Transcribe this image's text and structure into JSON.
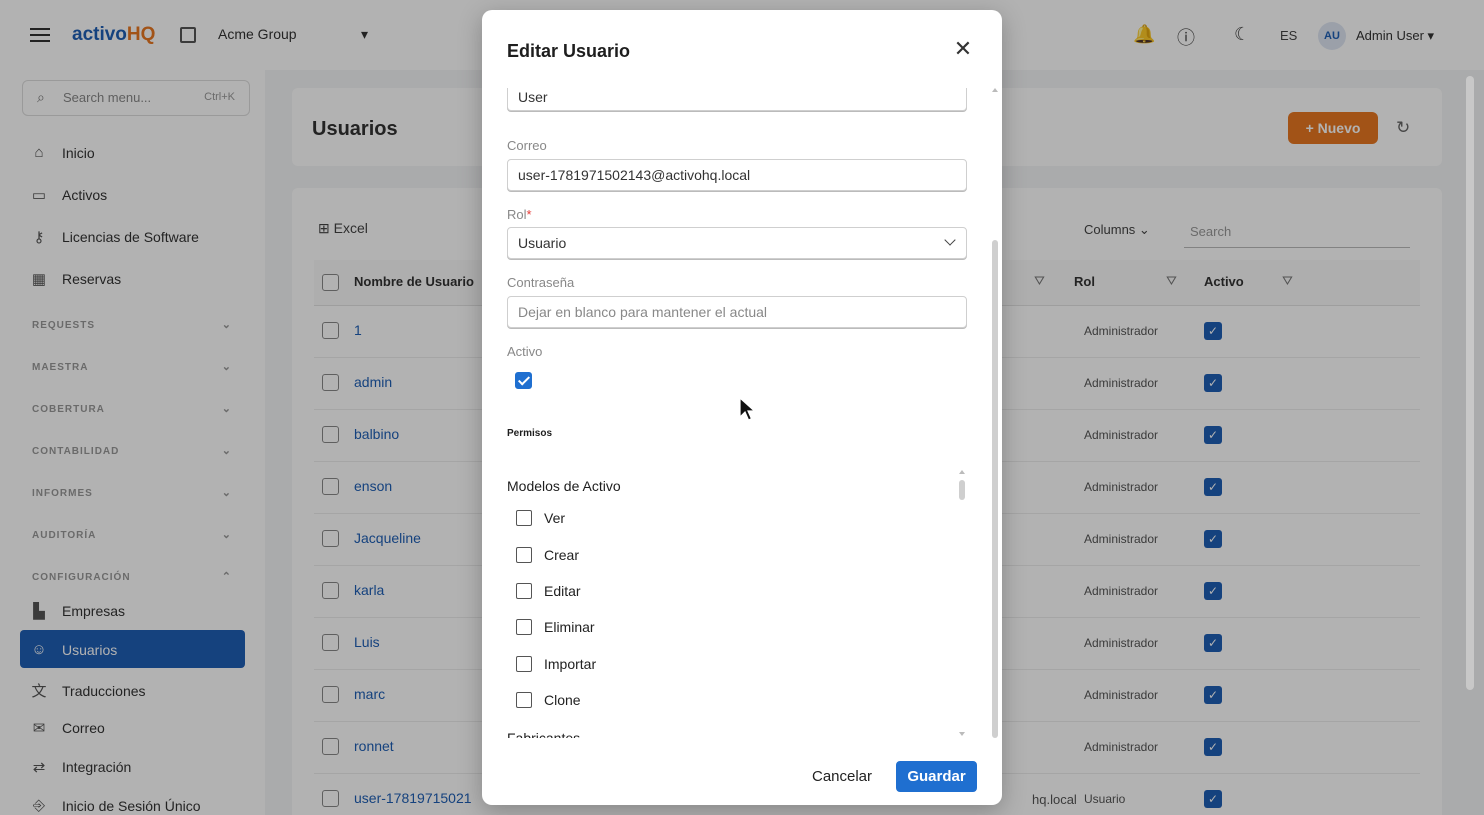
{
  "app": {
    "logo_main": "activo",
    "logo_accent": "HQ",
    "company": "Acme Group",
    "language": "ES",
    "avatar_initials": "AU",
    "user_name": "Admin User"
  },
  "sidebar": {
    "search_placeholder": "Search menu...",
    "search_shortcut": "Ctrl+K",
    "items_top": [
      "Inicio",
      "Activos",
      "Licencias de Software",
      "Reservas"
    ],
    "sections": [
      "REQUESTS",
      "MAESTRA",
      "COBERTURA",
      "CONTABILIDAD",
      "INFORMES",
      "AUDITORÍA",
      "CONFIGURACIÓN"
    ],
    "items_config": [
      "Empresas",
      "Usuarios",
      "Traducciones",
      "Correo",
      "Integración",
      "Inicio de Sesión Único"
    ]
  },
  "page": {
    "title": "Usuarios",
    "new_button": "+ Nuevo"
  },
  "table": {
    "excel_label": "Excel",
    "columns_label": "Columns",
    "search_placeholder": "Search",
    "headers": [
      "Nombre de Usuario",
      "Rol",
      "Activo"
    ],
    "rows": [
      {
        "username": "1",
        "role": "Administrador"
      },
      {
        "username": "admin",
        "role": "Administrador"
      },
      {
        "username": "balbino",
        "role": "Administrador"
      },
      {
        "username": "enson",
        "role": "Administrador"
      },
      {
        "username": "Jacqueline",
        "role": "Administrador"
      },
      {
        "username": "karla",
        "role": "Administrador"
      },
      {
        "username": "Luis",
        "role": "Administrador"
      },
      {
        "username": "marc",
        "role": "Administrador"
      },
      {
        "username": "ronnet",
        "role": "Administrador"
      },
      {
        "username": "user-17819715021",
        "role": "Usuario"
      }
    ],
    "last_row_email_fragment": "hq.local"
  },
  "modal": {
    "title": "Editar Usuario",
    "fields": {
      "name_value": "User",
      "email_label": "Correo",
      "email_value": "user-1781971502143@activohq.local",
      "role_label": "Rol",
      "role_required": "*",
      "role_value": "Usuario",
      "password_label": "Contraseña",
      "password_placeholder": "Dejar en blanco para mantener el actual",
      "active_label": "Activo",
      "active_checked": true
    },
    "permissions_heading": "Permisos",
    "permission_groups": [
      {
        "name": "Modelos de Activo",
        "items": [
          "Ver",
          "Crear",
          "Editar",
          "Eliminar",
          "Importar",
          "Clone"
        ]
      },
      {
        "name": "Fabricantes",
        "items": []
      }
    ],
    "cancel_label": "Cancelar",
    "save_label": "Guardar"
  },
  "colors": {
    "primary": "#1f6fd0",
    "brand_blue": "#1f5fb5",
    "brand_orange": "#e87722"
  }
}
